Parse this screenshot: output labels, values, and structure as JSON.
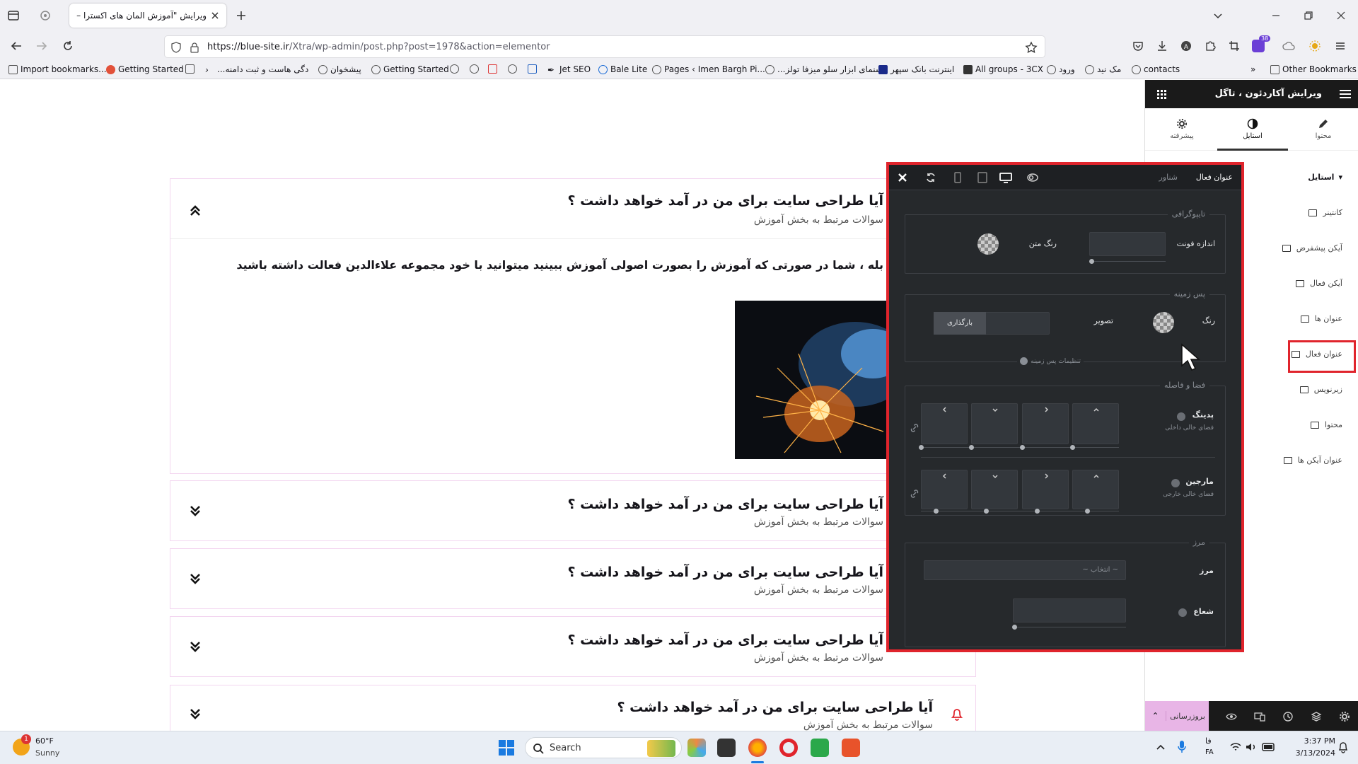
{
  "browser": {
    "tab_title": "ویرایش \"آموزش المان های اکسترا – ع",
    "url_domain": "https://blue-site.ir",
    "url_path": "/Xtra/wp-admin/post.php?post=1978&action=elementor",
    "extensions_badge": "38",
    "bookmarks": [
      "Import bookmarks...",
      "Getting Started",
      "...دگی هاست و ثبت دامنه",
      "پیشخوان",
      "Getting Started",
      "Jet SEO",
      "Bale Lite",
      "Pages ‹ Imen Bargh Pi...",
      "...سنمای ابزار سلو میزفا تولز",
      "اینترنت بانک سپهر",
      "All groups - 3CX",
      "ورود",
      "مک نید",
      "contacts"
    ],
    "other_bookmarks": "Other Bookmarks"
  },
  "page": {
    "faq_items": [
      {
        "question": "آیا طراحی سایت برای من در آمد خواهد داشت ؟",
        "subtitle": "سوالات مرتبط به بخش آموزش",
        "open": true
      },
      {
        "question": "آیا طراحی سایت برای من در آمد خواهد داشت ؟",
        "subtitle": "سوالات مرتبط به بخش آموزش",
        "open": false
      },
      {
        "question": "آیا طراحی سایت برای من در آمد خواهد داشت ؟",
        "subtitle": "سوالات مرتبط به بخش آموزش",
        "open": false
      },
      {
        "question": "آیا طراحی سایت برای من در آمد خواهد داشت ؟",
        "subtitle": "سوالات مرتبط به بخش آموزش",
        "open": false
      },
      {
        "question": "آیا طراحی سایت برای من در آمد خواهد داشت ؟",
        "subtitle": "سوالات مرتبط به بخش آموزش",
        "open": false
      }
    ],
    "answer_text": "بله ، شما در صورتی که آموزش را بصورت اصولی آموزش ببینید میتوانید با خود مجموعه علاءالدین فعالت داشته باشید"
  },
  "elementor": {
    "header_title": "ویرایش آکاردئون ، تاگل",
    "tabs": [
      "محتوا",
      "استایل",
      "پیشرفته"
    ],
    "active_tab": "استایل",
    "section_title": "استایل",
    "side_items": [
      "کانتینر",
      "آیکن پیشفرض",
      "آیکن فعال",
      "عنوان ها",
      "عنوان فعال",
      "زیرنویس",
      "محتوا",
      "عنوان آیکن ها"
    ],
    "highlighted_item": "عنوان فعال",
    "update_button": "بروزرسانی"
  },
  "style_panel": {
    "tab_active": "عنوان فعال",
    "tab_hover": "شناور",
    "typography": {
      "legend": "تایپوگرافی",
      "font_size": "اندازه فونت",
      "text_color": "رنگ متن"
    },
    "background": {
      "legend": "پس زمینه",
      "color": "رنگ",
      "image": "تصویر",
      "upload": "بارگذاری",
      "settings": "تنظیمات پس زمینه"
    },
    "spacing": {
      "legend": "فضا و فاصله",
      "padding": "پدینگ",
      "padding_sub": "فضای خالی داخلی",
      "margin": "مارجین",
      "margin_sub": "فضای خالی خارجی"
    },
    "border": {
      "legend": "مرز",
      "label": "مرز",
      "select": "~ انتخاب ~",
      "radius": "شعاع"
    }
  },
  "taskbar": {
    "weather_temp": "60°F",
    "weather_desc": "Sunny",
    "weather_badge": "1",
    "search_placeholder": "Search",
    "lang": "فا",
    "lang_code": "FA",
    "time": "3:37 PM",
    "date": "3/13/2024"
  }
}
